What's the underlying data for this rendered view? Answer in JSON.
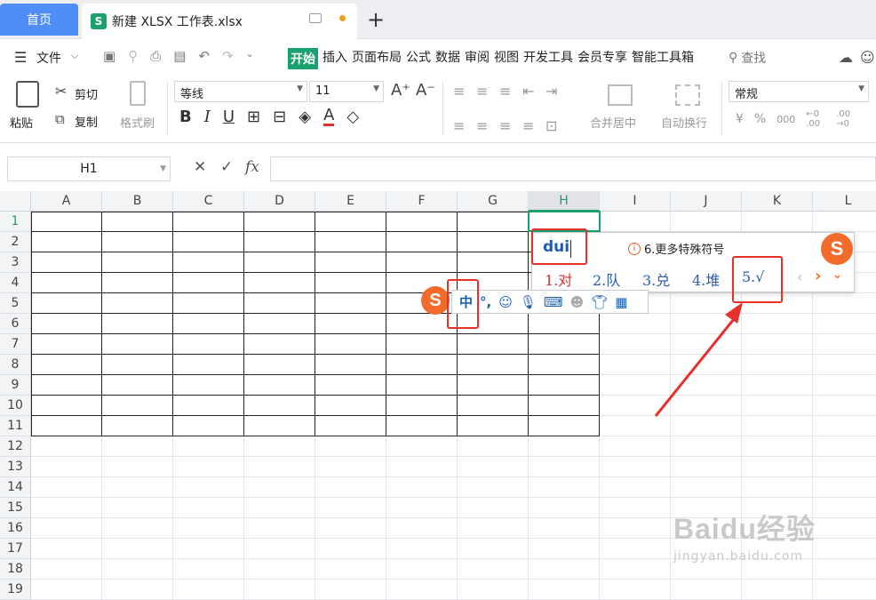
{
  "tabs": {
    "home": "首页",
    "doc_logo": "S",
    "doc_title": "新建 XLSX 工作表.xlsx",
    "add": "+"
  },
  "menu": {
    "file": "文件",
    "items": [
      "开始",
      "插入",
      "页面布局",
      "公式",
      "数据",
      "审阅",
      "视图",
      "开发工具",
      "会员专享",
      "智能工具箱"
    ],
    "search": "查找"
  },
  "ribbon": {
    "paste": "粘贴",
    "cut": "剪切",
    "copy": "复制",
    "format_painter": "格式刷",
    "font_name": "等线",
    "font_size": "11",
    "merge_center": "合并居中",
    "wrap_text": "自动换行",
    "number_format": "常规",
    "currency": "¥",
    "percent": "%",
    "thousands": "000",
    "dec_inc": "←0 .00",
    "dec_dec": ".00 →0"
  },
  "formula": {
    "name_box": "H1",
    "cancel": "✕",
    "confirm": "✓",
    "fx": "fx"
  },
  "columns": [
    "A",
    "B",
    "C",
    "D",
    "E",
    "F",
    "G",
    "H",
    "I",
    "J",
    "K",
    "L"
  ],
  "rows": [
    "1",
    "2",
    "3",
    "4",
    "5",
    "6",
    "7",
    "8",
    "9",
    "10",
    "11",
    "12",
    "13",
    "14",
    "15",
    "16",
    "17",
    "18",
    "19"
  ],
  "active_cell": "H1",
  "ime": {
    "input": "dui",
    "hint": "6.更多特殊符号",
    "candidates": [
      "1.对",
      "2.队",
      "3.兑",
      "4.堆",
      "5.√"
    ],
    "logo": "S",
    "mode": "中",
    "punct": "°,"
  },
  "watermark": {
    "main": "Baidu经验",
    "sub": "jingyan.baidu.com"
  },
  "colors": {
    "accent": "#1aa16d",
    "home_tab": "#4f8ef7",
    "annotation": "#e8302a",
    "sogou": "#f26b2a"
  }
}
